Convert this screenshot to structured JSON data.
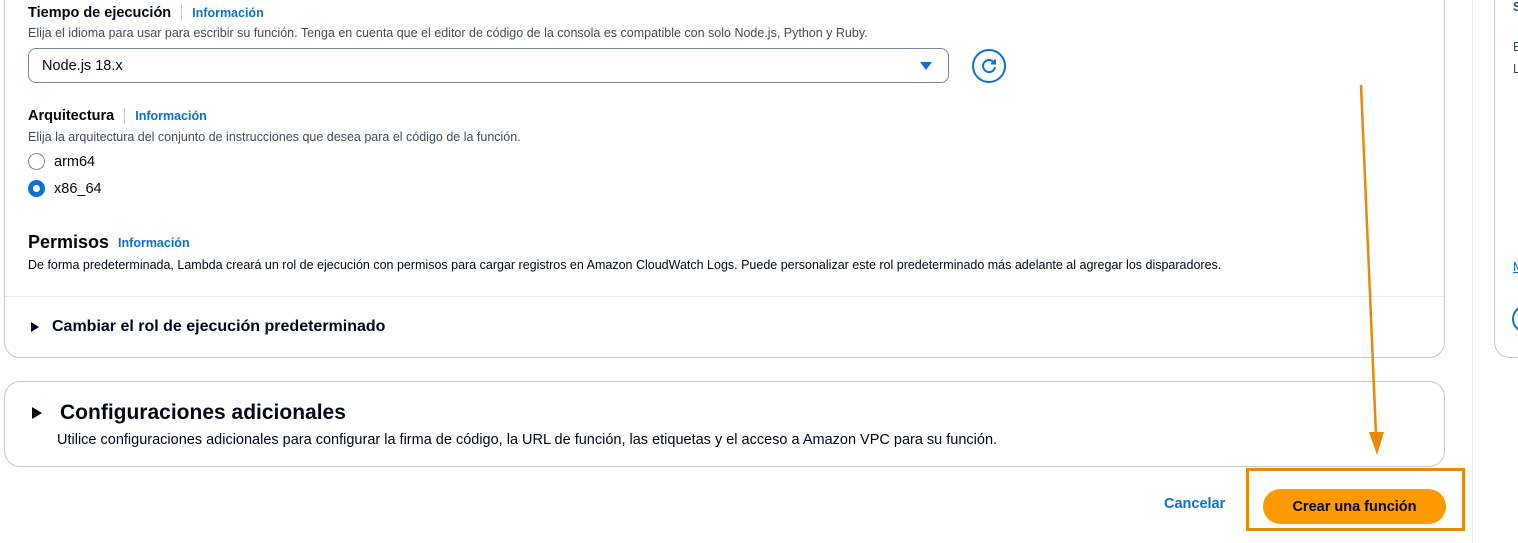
{
  "runtime": {
    "label": "Tiempo de ejecución",
    "info": "Información",
    "description": "Elija el idioma para usar para escribir su función. Tenga en cuenta que el editor de código de la consola es compatible con solo Node.js, Python y Ruby.",
    "selected": "Node.js 18.x"
  },
  "architecture": {
    "label": "Arquitectura",
    "info": "Información",
    "description": "Elija la arquitectura del conjunto de instrucciones que desea para el código de la función.",
    "options": [
      {
        "label": "arm64",
        "checked": false
      },
      {
        "label": "x86_64",
        "checked": true
      }
    ]
  },
  "permissions": {
    "title": "Permisos",
    "info": "Información",
    "description": "De forma predeterminada, Lambda creará un rol de ejecución con permisos para cargar registros en Amazon CloudWatch Logs. Puede personalizar este rol predeterminado más adelante al agregar los disparadores.",
    "expander": "Cambiar el rol de ejecución predeterminado"
  },
  "additional": {
    "title": "Configuraciones adicionales",
    "description": "Utilice configuraciones adicionales para configurar la firma de código, la URL de función, las etiquetas y el acceso a Amazon VPC para su función."
  },
  "actions": {
    "cancel": "Cancelar",
    "create": "Crear una función"
  },
  "side_panel": {
    "chars": [
      "S",
      "E",
      "L"
    ],
    "link_char": "M"
  },
  "colors": {
    "accent": "#0972d3",
    "primary_button": "#ff9900",
    "annotation": "#e8890c"
  },
  "icons": {
    "refresh": "refresh-icon",
    "select_caret": "caret-down-icon",
    "expand": "caret-right-icon"
  }
}
